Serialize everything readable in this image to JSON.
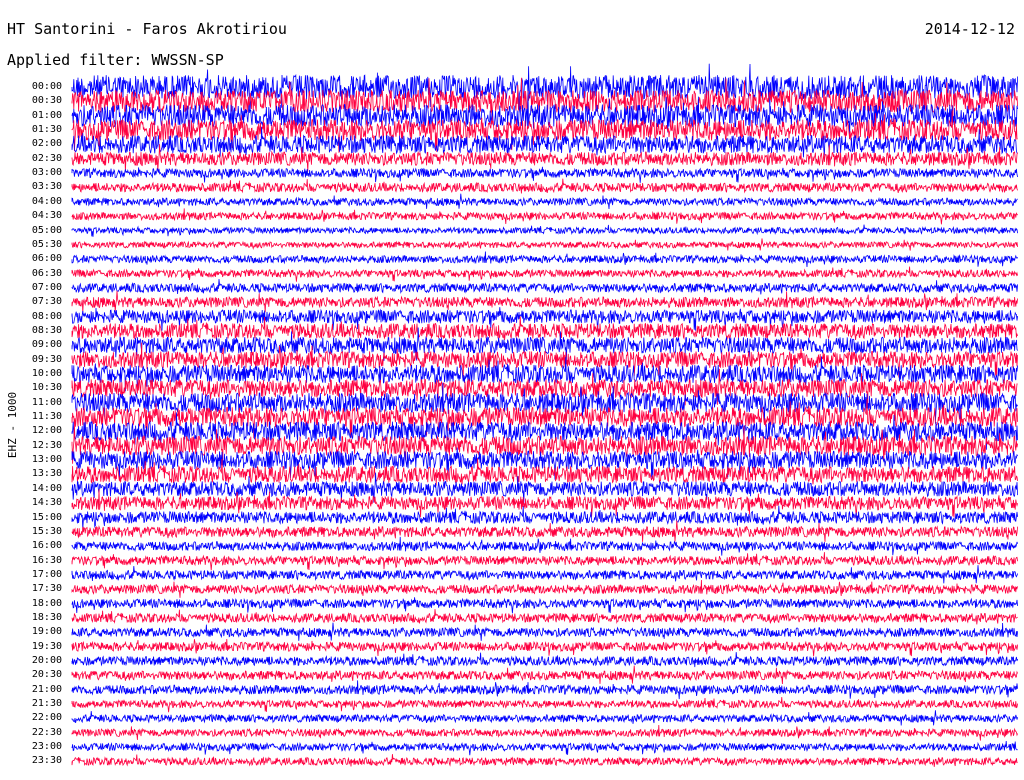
{
  "header": {
    "station": "HT Santorini - Faros Akrotiriou",
    "date": "2014-12-12",
    "filter": "Applied filter: WWSSN-SP"
  },
  "chart_data": {
    "type": "line",
    "title": "HT Santorini - Faros Akrotiriou",
    "subtitle": "Applied filter: WWSSN-SP",
    "date": "2014-12-12",
    "ylabel": "EHZ - 1000",
    "xlabel": "",
    "row_labels": [
      "00:00",
      "00:30",
      "01:00",
      "01:30",
      "02:00",
      "02:30",
      "03:00",
      "03:30",
      "04:00",
      "04:30",
      "05:00",
      "05:30",
      "06:00",
      "06:30",
      "07:00",
      "07:30",
      "08:00",
      "08:30",
      "09:00",
      "09:30",
      "10:00",
      "10:30",
      "11:00",
      "11:30",
      "12:00",
      "12:30",
      "13:00",
      "13:30",
      "14:00",
      "14:30",
      "15:00",
      "15:30",
      "16:00",
      "16:30",
      "17:00",
      "17:30",
      "18:00",
      "18:30",
      "19:00",
      "19:30",
      "20:00",
      "20:30",
      "21:00",
      "21:30",
      "22:00",
      "22:30",
      "23:00",
      "23:30"
    ],
    "colors": [
      "#0000ff",
      "#ff0040"
    ],
    "grid": false,
    "legend": "none",
    "relative_amplitude": [
      1.6,
      1.5,
      1.5,
      1.4,
      1.2,
      0.9,
      0.6,
      0.6,
      0.5,
      0.5,
      0.4,
      0.4,
      0.5,
      0.5,
      0.6,
      0.7,
      0.9,
      1.0,
      1.1,
      1.1,
      1.2,
      1.2,
      1.3,
      1.3,
      1.3,
      1.3,
      1.2,
      1.1,
      1.0,
      0.9,
      0.8,
      0.7,
      0.6,
      0.6,
      0.6,
      0.6,
      0.6,
      0.6,
      0.6,
      0.6,
      0.6,
      0.6,
      0.6,
      0.5,
      0.5,
      0.5,
      0.5,
      0.5
    ]
  }
}
